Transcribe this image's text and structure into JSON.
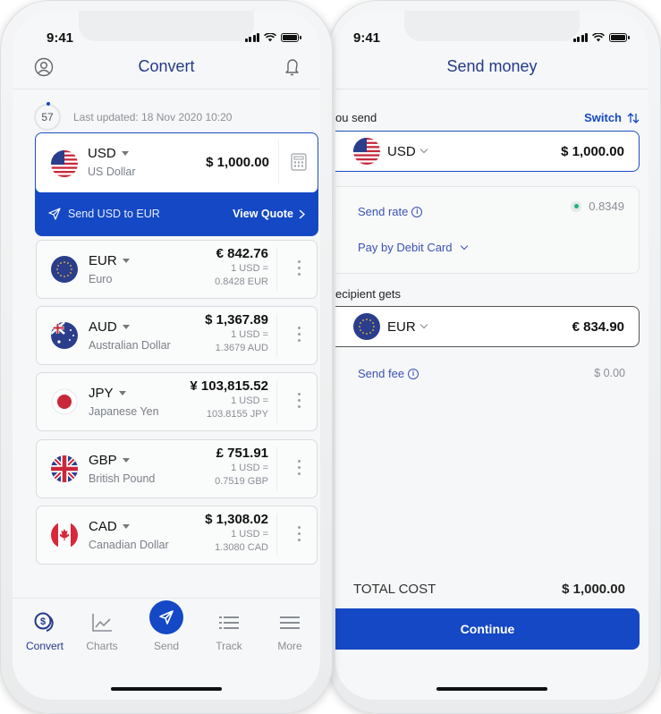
{
  "status_bar": {
    "time": "9:41"
  },
  "convert_screen": {
    "title": "Convert",
    "timer": "57",
    "last_updated": "Last updated: 18 Nov 2020 10:20",
    "base": {
      "code": "USD",
      "name": "US Dollar",
      "amount": "$ 1,000.00",
      "send_label": "Send USD to EUR",
      "quote_label": "View Quote"
    },
    "currencies": [
      {
        "code": "EUR",
        "name": "Euro",
        "amount": "€ 842.76",
        "rate_line1": "1 USD =",
        "rate_line2": "0.8428 EUR",
        "flag": "eu"
      },
      {
        "code": "AUD",
        "name": "Australian Dollar",
        "amount": "$ 1,367.89",
        "rate_line1": "1 USD =",
        "rate_line2": "1.3679 AUD",
        "flag": "au"
      },
      {
        "code": "JPY",
        "name": "Japanese Yen",
        "amount": "¥ 103,815.52",
        "rate_line1": "1 USD =",
        "rate_line2": "103.8155 JPY",
        "flag": "jp"
      },
      {
        "code": "GBP",
        "name": "British Pound",
        "amount": "£ 751.91",
        "rate_line1": "1 USD =",
        "rate_line2": "0.7519 GBP",
        "flag": "gb"
      },
      {
        "code": "CAD",
        "name": "Canadian Dollar",
        "amount": "$ 1,308.02",
        "rate_line1": "1 USD =",
        "rate_line2": "1.3080 CAD",
        "flag": "ca"
      }
    ],
    "tabs": [
      {
        "label": "Convert",
        "icon": "dollar-coins-icon",
        "active": true
      },
      {
        "label": "Charts",
        "icon": "line-chart-icon",
        "active": false
      },
      {
        "label": "Send",
        "icon": "paper-plane-icon",
        "active": false
      },
      {
        "label": "Track",
        "icon": "list-icon",
        "active": false
      },
      {
        "label": "More",
        "icon": "menu-icon",
        "active": false
      }
    ]
  },
  "send_screen": {
    "title": "Send money",
    "you_send_label": "ou send",
    "switch_label": "Switch",
    "send_code": "USD",
    "send_amount": "$ 1,000.00",
    "send_rate_label": "Send rate",
    "send_rate_value": "0.8349",
    "pay_method": "Pay by Debit Card",
    "recipient_label": "ecipient gets",
    "recv_code": "EUR",
    "recv_amount": "€ 834.90",
    "send_fee_label": "Send fee",
    "send_fee_value": "$ 0.00",
    "total_label": "TOTAL COST",
    "total_value": "$ 1,000.00",
    "continue_label": "Continue"
  },
  "colors": {
    "brand": "#1448c4",
    "title": "#233a8a",
    "live": "#21b07a"
  }
}
